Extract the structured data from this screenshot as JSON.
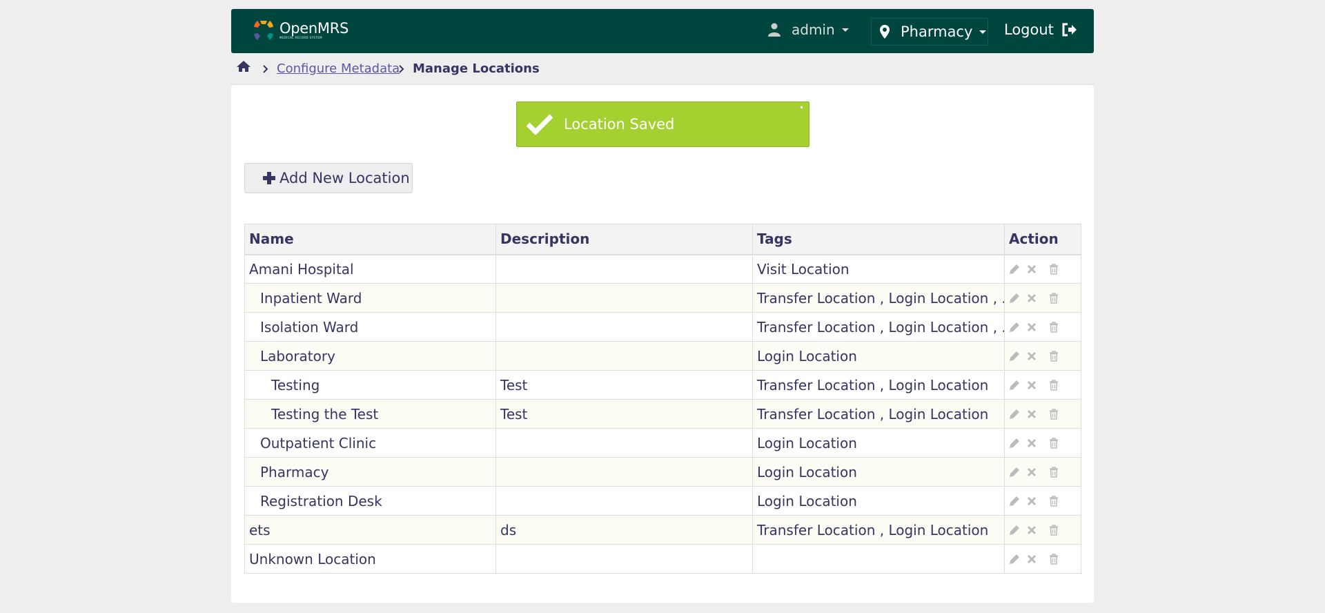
{
  "header": {
    "logo_name": "OpenMRS",
    "logo_sub": "MEDICAL RECORD SYSTEM",
    "user": "admin",
    "location": "Pharmacy",
    "logout": "Logout"
  },
  "breadcrumb": {
    "link": "Configure Metadata",
    "current": "Manage Locations"
  },
  "toast": {
    "message": "Location Saved"
  },
  "add_button": "Add New Location",
  "table": {
    "headers": [
      "Name",
      "Description",
      "Tags",
      "Action"
    ],
    "rows": [
      {
        "name": "Amani Hospital",
        "description": "",
        "tags": "Visit Location",
        "level": 0
      },
      {
        "name": "Inpatient Ward",
        "description": "",
        "tags": "Transfer Location , Login Location , ...",
        "level": 1
      },
      {
        "name": "Isolation Ward",
        "description": "",
        "tags": "Transfer Location , Login Location , ...",
        "level": 1
      },
      {
        "name": "Laboratory",
        "description": "",
        "tags": "Login Location",
        "level": 1
      },
      {
        "name": "Testing",
        "description": "Test",
        "tags": "Transfer Location , Login Location",
        "level": 2
      },
      {
        "name": "Testing the Test",
        "description": "Test",
        "tags": "Transfer Location , Login Location",
        "level": 2
      },
      {
        "name": "Outpatient Clinic",
        "description": "",
        "tags": "Login Location",
        "level": 1
      },
      {
        "name": "Pharmacy",
        "description": "",
        "tags": "Login Location",
        "level": 1
      },
      {
        "name": "Registration Desk",
        "description": "",
        "tags": "Login Location",
        "level": 1
      },
      {
        "name": "ets",
        "description": "ds",
        "tags": "Transfer Location , Login Location",
        "level": 0
      },
      {
        "name": "Unknown Location",
        "description": "",
        "tags": "",
        "level": 0
      }
    ]
  },
  "colors": {
    "header_bg": "#00463f",
    "toast_bg": "#a4d12f",
    "text": "#363463",
    "link": "#5b57a6"
  },
  "icons": [
    "openmrs-logo-icon",
    "user-icon",
    "map-pin-icon",
    "logout-icon",
    "home-icon",
    "chevron-right-icon",
    "check-icon",
    "plus-icon",
    "pencil-icon",
    "x-icon",
    "trash-icon"
  ]
}
